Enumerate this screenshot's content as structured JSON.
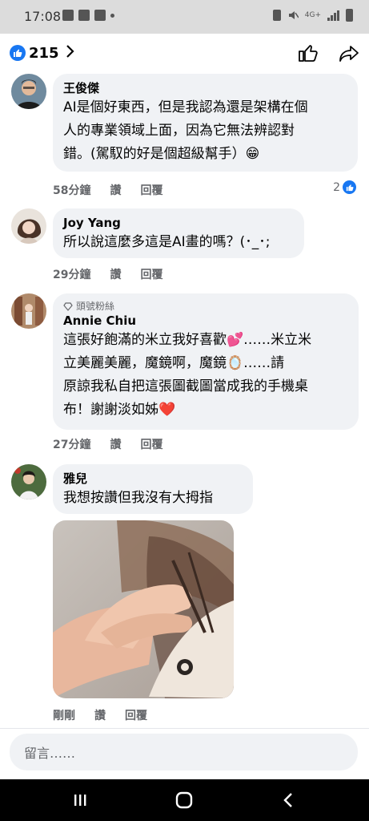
{
  "status_bar": {
    "time": "17:08",
    "network": "4G+"
  },
  "header": {
    "reaction_count": "215"
  },
  "comments": [
    {
      "author": "王俊傑",
      "lines": [
        "AI是個好東西，但是我認為還是架構在個",
        "人的專業領域上面，因為它無法辨認對",
        "錯。(駕馭的好是個超級幫手）😁"
      ],
      "time": "58分鐘",
      "like_label": "讚",
      "reply_label": "回覆",
      "reaction_count": "2"
    },
    {
      "author": "Joy Yang",
      "lines": [
        "所以說這麼多這是AI畫的嗎？(･_･;"
      ],
      "time": "29分鐘",
      "like_label": "讚",
      "reply_label": "回覆"
    },
    {
      "badge": "頭號粉絲",
      "author": "Annie Chiu",
      "lines": [
        "這張好飽滿的米立我好喜歡💕……米立米",
        "立美麗美麗，￼魔鏡啊，魔鏡🪞……￼請",
        "原諒我私自把這張圖截圖當成我的手機桌",
        "布！謝謝淡如姊❤️"
      ],
      "time": "27分鐘",
      "like_label": "讚",
      "reply_label": "回覆"
    },
    {
      "author": "雅兒",
      "lines": [
        "我想按讚但我沒有大拇指"
      ],
      "time": "剛剛",
      "like_label": "讚",
      "reply_label": "回覆"
    }
  ],
  "composer": {
    "placeholder": "留言……"
  },
  "colors": {
    "accent": "#1877f2",
    "bubble": "#f0f2f5",
    "meta": "#65676b"
  },
  "icons": [
    "like-thumb-icon",
    "share-arrow-icon",
    "chevron-right-icon",
    "diamond-badge-icon",
    "recent-apps-icon",
    "home-icon",
    "back-icon"
  ]
}
